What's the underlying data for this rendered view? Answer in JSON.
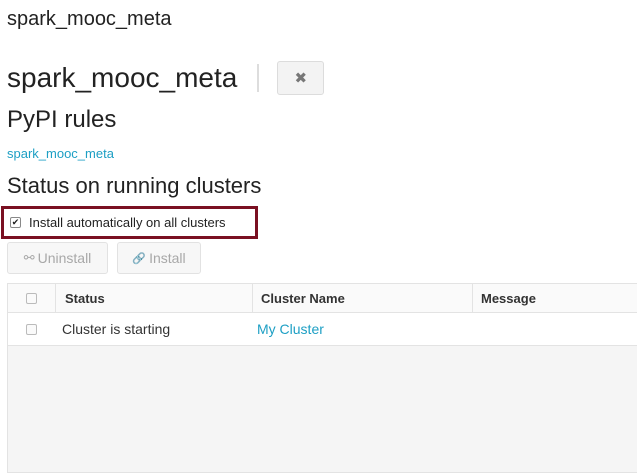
{
  "breadcrumb": {
    "text": "spark_mooc_meta"
  },
  "header": {
    "title": "spark_mooc_meta",
    "close_icon": "close-icon",
    "close_glyph": "✖"
  },
  "pypi": {
    "heading": "PyPI rules",
    "package_link": "spark_mooc_meta"
  },
  "status_section": {
    "heading": "Status on running clusters",
    "auto_install": {
      "checked": true,
      "label": "Install automatically on all clusters",
      "highlight_color": "#7a1022"
    },
    "buttons": {
      "uninstall": {
        "label": "Uninstall",
        "icon": "unlink-icon",
        "glyph": "⚯"
      },
      "install": {
        "label": "Install",
        "icon": "link-icon",
        "glyph": "🔗"
      }
    }
  },
  "table": {
    "columns": [
      "Status",
      "Cluster Name",
      "Message"
    ],
    "rows": [
      {
        "status": "Cluster is starting",
        "cluster_name": "My Cluster",
        "message": ""
      }
    ]
  },
  "colors": {
    "link": "#1d9fc4",
    "text": "#222222"
  }
}
